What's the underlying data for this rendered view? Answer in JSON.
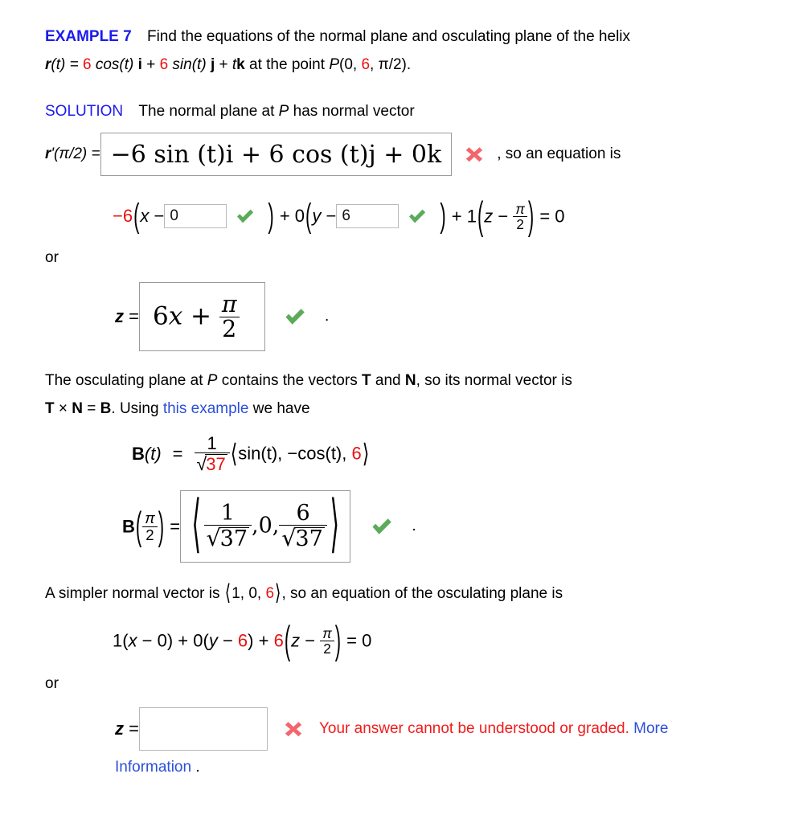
{
  "header": {
    "example_label": "EXAMPLE 7",
    "prompt_line1": "Find the equations of the normal plane and osculating plane of the helix",
    "r_label": "r",
    "r_arg": "(t) = ",
    "coef_a": "6",
    "cos_part": " cos(t) ",
    "i_vec": "i",
    "plus1": " + ",
    "coef_b": "6",
    "sin_part": " sin(t) ",
    "j_vec": "j",
    "plus2": " + ",
    "tk": "t",
    "k_vec": "k",
    "at_point": " at the point  ",
    "point_p": "P",
    "point_open": "(0, ",
    "point_y": "6",
    "point_rest": ", π/2)."
  },
  "solution": {
    "label": "SOLUTION",
    "intro_a": "The normal plane at ",
    "intro_p": "P",
    "intro_b": " has normal vector"
  },
  "row_rprime": {
    "label_r": "r",
    "label_rest": "'(π/2) = ",
    "boxed_answer": "−6 sin (t)i + 6 cos (t)j + 0k",
    "status": "incorrect",
    "status_icon": "cross-icon",
    "trailing_text": ",  so an equation is"
  },
  "row_plane_eq": {
    "coef_neg6": "−6",
    "var_x": "x",
    "minus": " − ",
    "input1_value": "0",
    "input1_status": "correct",
    "plus_zero": " + 0",
    "var_y": "y",
    "input2_value": "6",
    "input2_status": "correct",
    "plus_one": " + 1",
    "var_z": "z",
    "pi": "π",
    "two": "2",
    "equals_zero": " = 0"
  },
  "or_label_1": "or",
  "row_z_answer": {
    "z_label": "z",
    "equals": " = ",
    "boxed_coef": "6",
    "boxed_var": "x",
    "boxed_plus": " + ",
    "boxed_num": "π",
    "boxed_den": "2",
    "status": "correct",
    "status_icon": "check-icon",
    "period": "."
  },
  "osculating": {
    "line1_a": "The osculating plane at ",
    "line1_p": "P",
    "line1_b": " contains the vectors ",
    "vec_T": "T",
    "line1_c": " and ",
    "vec_N": "N",
    "line1_d": ", so its normal vector is",
    "line2_T": "T",
    "line2_times": " × ",
    "line2_N": "N",
    "line2_eq": " = ",
    "line2_B": "B",
    "line2_using": ".  Using ",
    "link_text": "this example",
    "line2_end": " we have"
  },
  "row_Bt": {
    "B_label": "B",
    "B_arg": "(t)",
    "equals": "=",
    "frac_num": "1",
    "radicand": "37",
    "vec_open": "⟨",
    "comp1": "sin(t), ",
    "comp2": "−cos(t), ",
    "comp3": "6",
    "vec_close": "⟩"
  },
  "row_Bhalf": {
    "B_label": "B",
    "pi": "π",
    "two": "2",
    "equals": " = ",
    "boxed_num1": "1",
    "boxed_rad1": "37",
    "boxed_zero": ",0,",
    "boxed_num2": "6",
    "boxed_rad2": "37",
    "status": "correct",
    "status_icon": "check-icon",
    "period": "."
  },
  "simpler": {
    "text_a": "A simpler normal vector is  ",
    "vec_open": "⟨",
    "v1": "1, 0, ",
    "v2": "6",
    "vec_close": "⟩",
    "text_b": ",  so an equation of the osculating plane is"
  },
  "row_final_eq": {
    "part1": "1(",
    "var_x": "x",
    "part2": " − 0) + 0(",
    "var_y": "y",
    "part3": " − ",
    "six_a": "6",
    "part4": ") + ",
    "six_b": "6",
    "var_z": "z",
    "minus": " − ",
    "pi": "π",
    "two": "2",
    "equals_zero": " = 0"
  },
  "or_label_2": "or",
  "row_final_answer": {
    "z_label": "z",
    "equals": " = ",
    "input_value": "",
    "input_placeholder": "",
    "status": "incorrect",
    "status_icon": "cross-icon",
    "error_text": "Your answer cannot be understood or graded. ",
    "more_link_1": "More",
    "more_link_2": "Information",
    "period": "."
  },
  "colors": {
    "heading_blue": "#1b1bee",
    "link_blue": "#2b4fd8",
    "value_red": "#e8110f",
    "error_red": "#f21b1b",
    "check_green": "#5aab5a",
    "cross_pink": "#f4666c",
    "box_border": "#9a9a9a",
    "input_border": "#b9b9b9"
  }
}
